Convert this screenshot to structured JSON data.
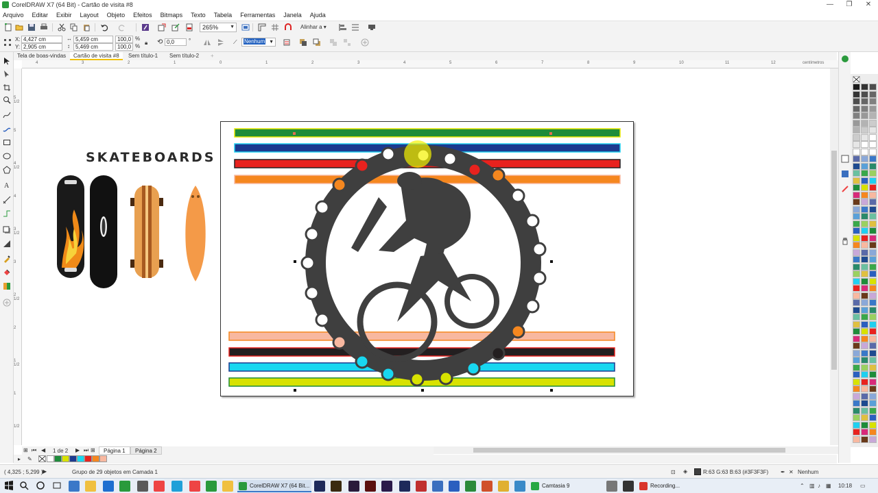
{
  "window": {
    "title": "CorelDRAW X7 (64 Bit) - Cartão de visita #8",
    "minimize": "—",
    "maximize": "❐",
    "close": "✕"
  },
  "menu": [
    "Arquivo",
    "Editar",
    "Exibir",
    "Layout",
    "Objeto",
    "Efeitos",
    "Bitmaps",
    "Texto",
    "Tabela",
    "Ferramentas",
    "Janela",
    "Ajuda"
  ],
  "toolbar": {
    "zoom": "265%",
    "align_label": "Alinhar a"
  },
  "propbar": {
    "x_label": "X:",
    "x_value": "4,427 cm",
    "y_label": "Y:",
    "y_value": "2,905 cm",
    "w_value": "5,459 cm",
    "h_value": "5,469 cm",
    "scale_x": "100,0",
    "scale_y": "100,0",
    "percent": "%",
    "angle": "0,0",
    "degree": "°",
    "outline": "Nenhum"
  },
  "tabs": [
    {
      "label": "Tela de boas-vindas",
      "active": false
    },
    {
      "label": "Cartão de visita #8",
      "active": true
    },
    {
      "label": "Sem título-1",
      "active": false
    },
    {
      "label": "Sem título-2",
      "active": false
    }
  ],
  "ruler": {
    "units": "centímetros",
    "h_ticks": [
      "4",
      "3",
      "2",
      "1",
      "0",
      "1",
      "2",
      "3",
      "4",
      "5",
      "6",
      "7",
      "8",
      "9",
      "10",
      "11",
      "12"
    ],
    "v_ticks": [
      "5 1/2",
      "5",
      "4 1/2",
      "4",
      "3 1/2",
      "3",
      "2 1/2",
      "2",
      "1 1/2",
      "1",
      "1/2"
    ]
  },
  "artwork": {
    "skate_title": "SKATEBOARDS",
    "stripe_colors": [
      "#1e8c3a",
      "#1c3a8f",
      "#e8221e",
      "#f5871f",
      "#f8b8a0",
      "#231f20",
      "#18d7f0",
      "#d8e200"
    ],
    "chain_color": "#3f3f3f"
  },
  "pages": {
    "indicator": "1 de 2",
    "tabs": [
      "Página 1",
      "Página 2"
    ]
  },
  "doc_palette": [
    "#ffffff",
    "#1e8c3a",
    "#d8e200",
    "#1c3a8f",
    "#18d7f0",
    "#e8221e",
    "#f5871f",
    "#f8b8a0"
  ],
  "status": {
    "coords": "( 4,325 ; 5,299 )",
    "selection": "Grupo de 29 objetos em Camada 1",
    "fill": "R:63 G:63 B:63 (#3F3F3F)",
    "outline": "Nenhum"
  },
  "taskbar": {
    "items": [
      {
        "label": "CorelDRAW X7 (64 Bit...",
        "color": "#2a9a3c",
        "active": true
      },
      {
        "label": "Camtasia 9",
        "color": "#27a844",
        "active": false
      },
      {
        "label": "Recording...",
        "color": "#d9342b",
        "active": false
      }
    ],
    "time": "10:18"
  }
}
